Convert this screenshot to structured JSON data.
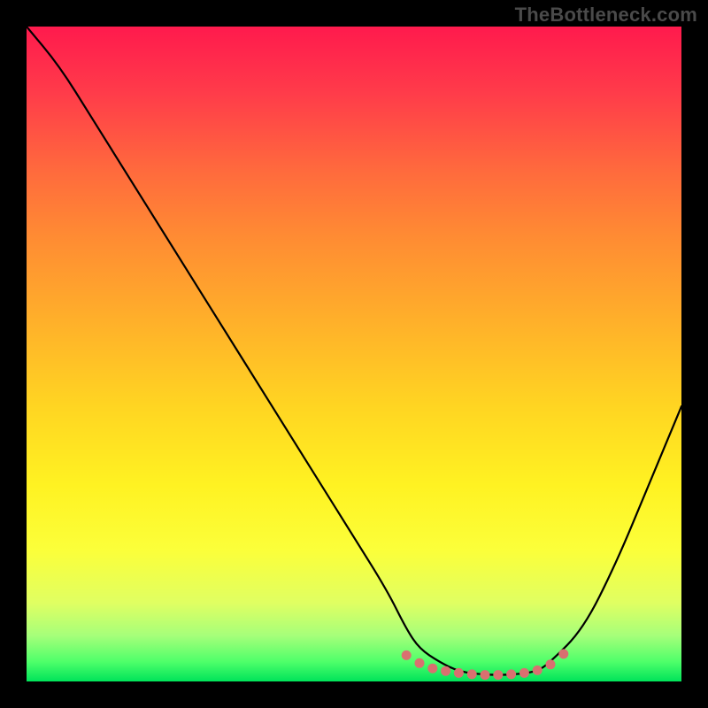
{
  "watermark": "TheBottleneck.com",
  "chart_data": {
    "type": "line",
    "title": "",
    "xlabel": "",
    "ylabel": "",
    "xlim": [
      0,
      100
    ],
    "ylim": [
      0,
      100
    ],
    "grid": false,
    "legend": false,
    "series": [
      {
        "name": "curve",
        "x": [
          0,
          5,
          10,
          15,
          20,
          25,
          30,
          35,
          40,
          45,
          50,
          55,
          58,
          60,
          63,
          66,
          70,
          74,
          78,
          80,
          85,
          90,
          95,
          100
        ],
        "values": [
          100,
          94,
          86,
          78,
          70,
          62,
          54,
          46,
          38,
          30,
          22,
          14,
          8,
          5,
          3,
          1.5,
          1,
          1,
          1.5,
          3,
          8,
          18,
          30,
          42
        ]
      }
    ],
    "markers": [
      {
        "name": "flat-region-dot",
        "x": 58,
        "y": 4.0
      },
      {
        "name": "flat-region-dot",
        "x": 60,
        "y": 2.8
      },
      {
        "name": "flat-region-dot",
        "x": 62,
        "y": 2.0
      },
      {
        "name": "flat-region-dot",
        "x": 64,
        "y": 1.6
      },
      {
        "name": "flat-region-dot",
        "x": 66,
        "y": 1.3
      },
      {
        "name": "flat-region-dot",
        "x": 68,
        "y": 1.1
      },
      {
        "name": "flat-region-dot",
        "x": 70,
        "y": 1.0
      },
      {
        "name": "flat-region-dot",
        "x": 72,
        "y": 1.0
      },
      {
        "name": "flat-region-dot",
        "x": 74,
        "y": 1.1
      },
      {
        "name": "flat-region-dot",
        "x": 76,
        "y": 1.3
      },
      {
        "name": "flat-region-dot",
        "x": 78,
        "y": 1.7
      },
      {
        "name": "flat-region-dot",
        "x": 80,
        "y": 2.6
      },
      {
        "name": "flat-region-dot",
        "x": 82,
        "y": 4.2
      }
    ],
    "gradient_stops": [
      {
        "pos": 0,
        "color": "#ff1a4d"
      },
      {
        "pos": 10,
        "color": "#ff3b4a"
      },
      {
        "pos": 22,
        "color": "#ff6a3d"
      },
      {
        "pos": 32,
        "color": "#ff8b33"
      },
      {
        "pos": 45,
        "color": "#ffb02a"
      },
      {
        "pos": 58,
        "color": "#ffd522"
      },
      {
        "pos": 70,
        "color": "#fff222"
      },
      {
        "pos": 80,
        "color": "#fbff3a"
      },
      {
        "pos": 88,
        "color": "#e0ff62"
      },
      {
        "pos": 93,
        "color": "#a6ff7a"
      },
      {
        "pos": 97,
        "color": "#4eff6a"
      },
      {
        "pos": 100,
        "color": "#00e35a"
      }
    ],
    "colors": {
      "curve": "#000000",
      "marker": "#d97070",
      "background_frame": "#000000"
    }
  }
}
